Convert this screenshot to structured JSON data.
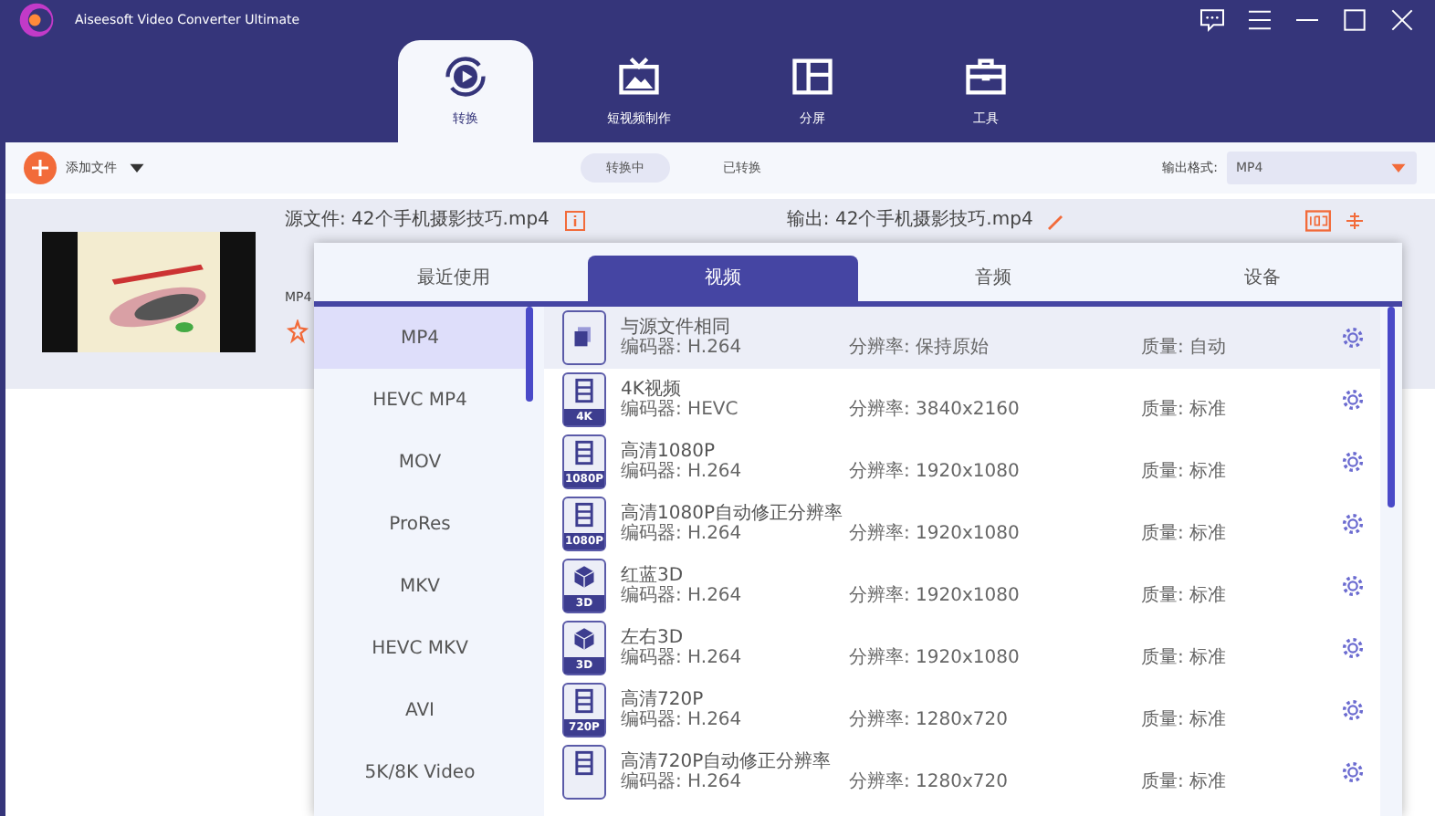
{
  "window": {
    "title": "Aiseesoft Video Converter Ultimate"
  },
  "main_tabs": [
    {
      "label": "转换",
      "kind": "convert",
      "selected": true
    },
    {
      "label": "短视频制作",
      "kind": "tv",
      "selected": false
    },
    {
      "label": "分屏",
      "kind": "split",
      "selected": false
    },
    {
      "label": "工具",
      "kind": "toolbox",
      "selected": false
    }
  ],
  "toolbar": {
    "add_files": "添加文件",
    "filter_tabs": [
      {
        "label": "转换中",
        "selected": true
      },
      {
        "label": "已转换",
        "selected": false
      }
    ],
    "output_format_label": "输出格式:",
    "output_format": "MP4"
  },
  "file": {
    "source": "源文件: 42个手机摄影技巧.mp4",
    "output": "输出: 42个手机摄影技巧.mp4",
    "format": "MP4"
  },
  "format_popup": {
    "tabs": [
      {
        "label": "最近使用",
        "selected": false
      },
      {
        "label": "视频",
        "selected": true
      },
      {
        "label": "音频",
        "selected": false
      },
      {
        "label": "设备",
        "selected": false
      }
    ],
    "formats": [
      {
        "label": "MP4",
        "selected": true
      },
      {
        "label": "HEVC MP4",
        "selected": false
      },
      {
        "label": "MOV",
        "selected": false
      },
      {
        "label": "ProRes",
        "selected": false
      },
      {
        "label": "MKV",
        "selected": false
      },
      {
        "label": "HEVC MKV",
        "selected": false
      },
      {
        "label": "AVI",
        "selected": false
      },
      {
        "label": "5K/8K Video",
        "selected": false
      }
    ],
    "presets": [
      {
        "kind": "copy",
        "name": "与源文件相同",
        "encoder": "编码器: H.264",
        "resolution": "分辨率: 保持原始",
        "quality": "质量: 自动",
        "selected": true
      },
      {
        "kind": "film",
        "badge": "4K",
        "name": "4K视频",
        "encoder": "编码器: HEVC",
        "resolution": "分辨率: 3840x2160",
        "quality": "质量: 标准",
        "selected": false
      },
      {
        "kind": "film",
        "badge": "1080P",
        "name": "高清1080P",
        "encoder": "编码器: H.264",
        "resolution": "分辨率: 1920x1080",
        "quality": "质量: 标准",
        "selected": false
      },
      {
        "kind": "film",
        "badge": "1080P",
        "name": "高清1080P自动修正分辨率",
        "encoder": "编码器: H.264",
        "resolution": "分辨率: 1920x1080",
        "quality": "质量: 标准",
        "selected": false
      },
      {
        "kind": "cube",
        "badge": "3D",
        "name": "红蓝3D",
        "encoder": "编码器: H.264",
        "resolution": "分辨率: 1920x1080",
        "quality": "质量: 标准",
        "selected": false
      },
      {
        "kind": "cube",
        "badge": "3D",
        "name": "左右3D",
        "encoder": "编码器: H.264",
        "resolution": "分辨率: 1920x1080",
        "quality": "质量: 标准",
        "selected": false
      },
      {
        "kind": "film",
        "badge": "720P",
        "name": "高清720P",
        "encoder": "编码器: H.264",
        "resolution": "分辨率: 1280x720",
        "quality": "质量: 标准",
        "selected": false
      },
      {
        "kind": "film",
        "name": "高清720P自动修正分辨率",
        "encoder": "编码器: H.264",
        "resolution": "分辨率: 1280x720",
        "quality": "质量: 标准",
        "selected": false
      }
    ]
  }
}
